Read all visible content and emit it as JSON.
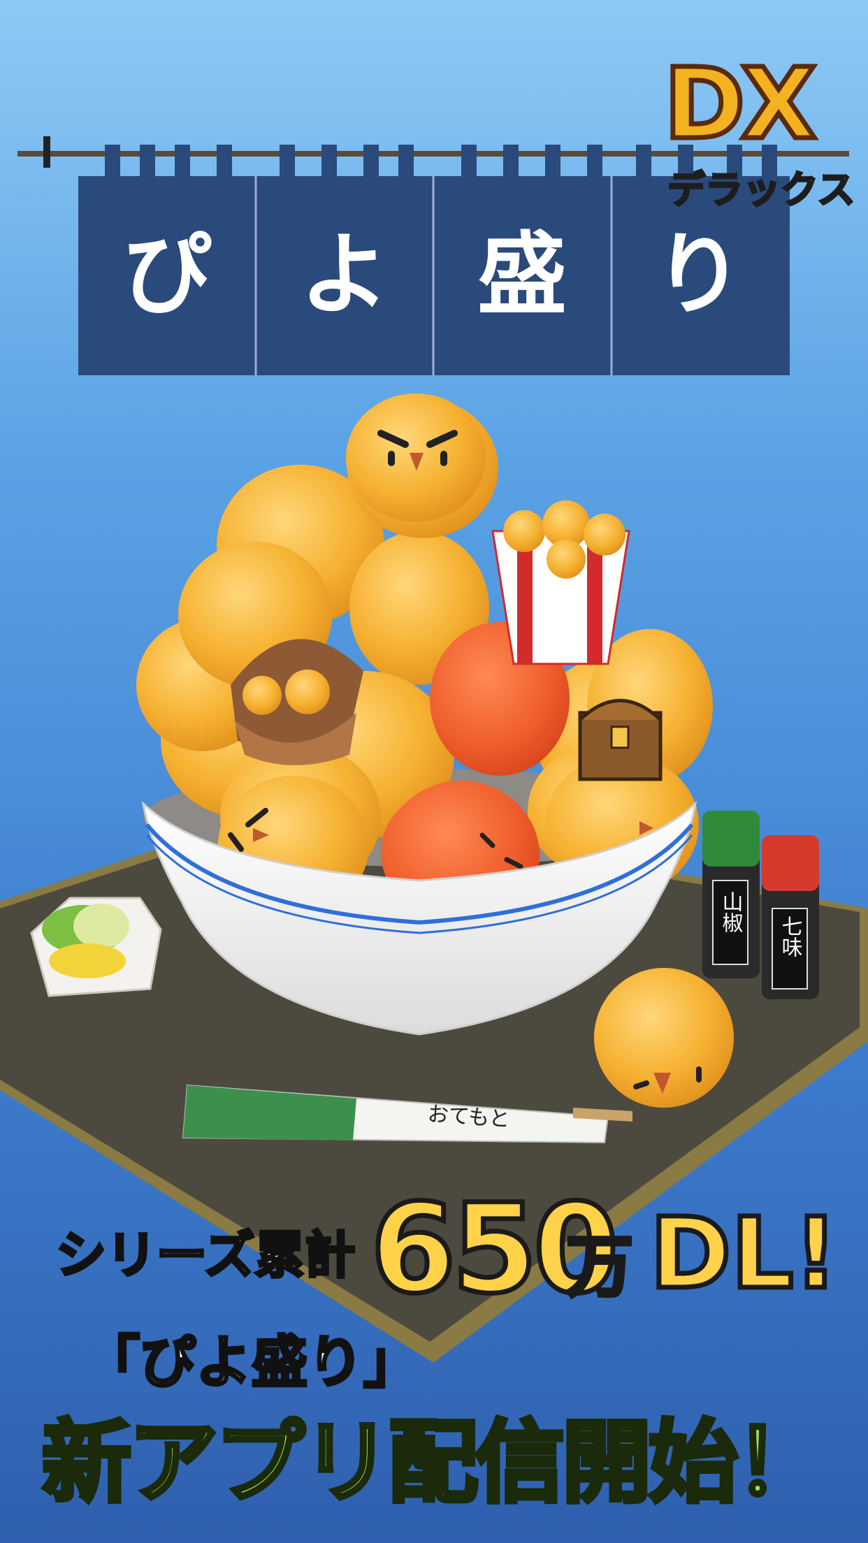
{
  "title": {
    "noren": [
      "ぴ",
      "よ",
      "盛",
      "り"
    ],
    "badge": "DX",
    "badge_sub": "デラックス"
  },
  "props": {
    "chopsticks_label": "おてもと",
    "bottle_left": "山椒",
    "bottle_right": "七味"
  },
  "promo": {
    "line1_prefix": "シリーズ累計",
    "line1_number": "650",
    "line1_unit": "万",
    "line1_suffix": "DL!",
    "line2": "「ぴよ盛り」",
    "line3": "新アプリ配信開始！"
  },
  "colors": {
    "noren": "#2b4a7c",
    "chick": "#f7b83a",
    "red_chick": "#ee5f2e",
    "bowl": "#f6f6f6",
    "bowl_stripe": "#2f6fd8",
    "tray": "#4e4a3f",
    "accent_yellow": "#ffd24a",
    "accent_green": "#9be34a"
  }
}
